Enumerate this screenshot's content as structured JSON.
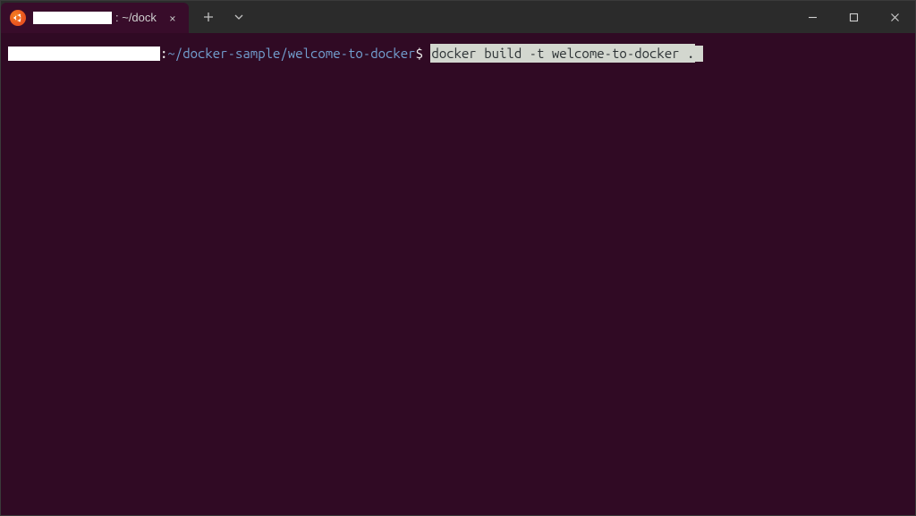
{
  "tab": {
    "title_suffix": ": ~/dock"
  },
  "prompt": {
    "colon": ":",
    "path": "~/docker-sample/welcome-to-docker",
    "dollar": "$",
    "command": "docker build -t welcome-to-docker ."
  },
  "icons": {
    "close_tab": "×",
    "new_tab": "+",
    "dropdown": "⌄"
  }
}
